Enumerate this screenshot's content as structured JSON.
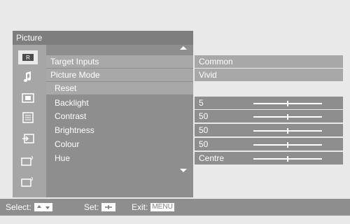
{
  "header": {
    "title": "Picture"
  },
  "sidebar": {
    "icons": [
      {
        "name": "picture-mode-icon"
      },
      {
        "name": "sound-icon"
      },
      {
        "name": "screen-icon"
      },
      {
        "name": "settings-icon"
      },
      {
        "name": "input-icon"
      },
      {
        "name": "preset-a-icon"
      },
      {
        "name": "preset-b-icon"
      }
    ]
  },
  "rows": [
    {
      "label": "Target Inputs",
      "value": "Common"
    },
    {
      "label": "Picture Mode",
      "value": "Vivid"
    },
    {
      "label": "Reset",
      "value": ""
    },
    {
      "label": "Backlight",
      "value": "5"
    },
    {
      "label": "Contrast",
      "value": "50"
    },
    {
      "label": "Brightness",
      "value": "50"
    },
    {
      "label": "Colour",
      "value": "50"
    },
    {
      "label": "Hue",
      "value": "Centre"
    }
  ],
  "footer": {
    "select_label": "Select:",
    "set_label": "Set:",
    "exit_label": "Exit:",
    "menu_key": "MENU"
  },
  "colors": {
    "panel": "#8e8e8e",
    "highlight": "#a8a8a8",
    "background": "#e9e9e9",
    "text": "#ffffff"
  }
}
